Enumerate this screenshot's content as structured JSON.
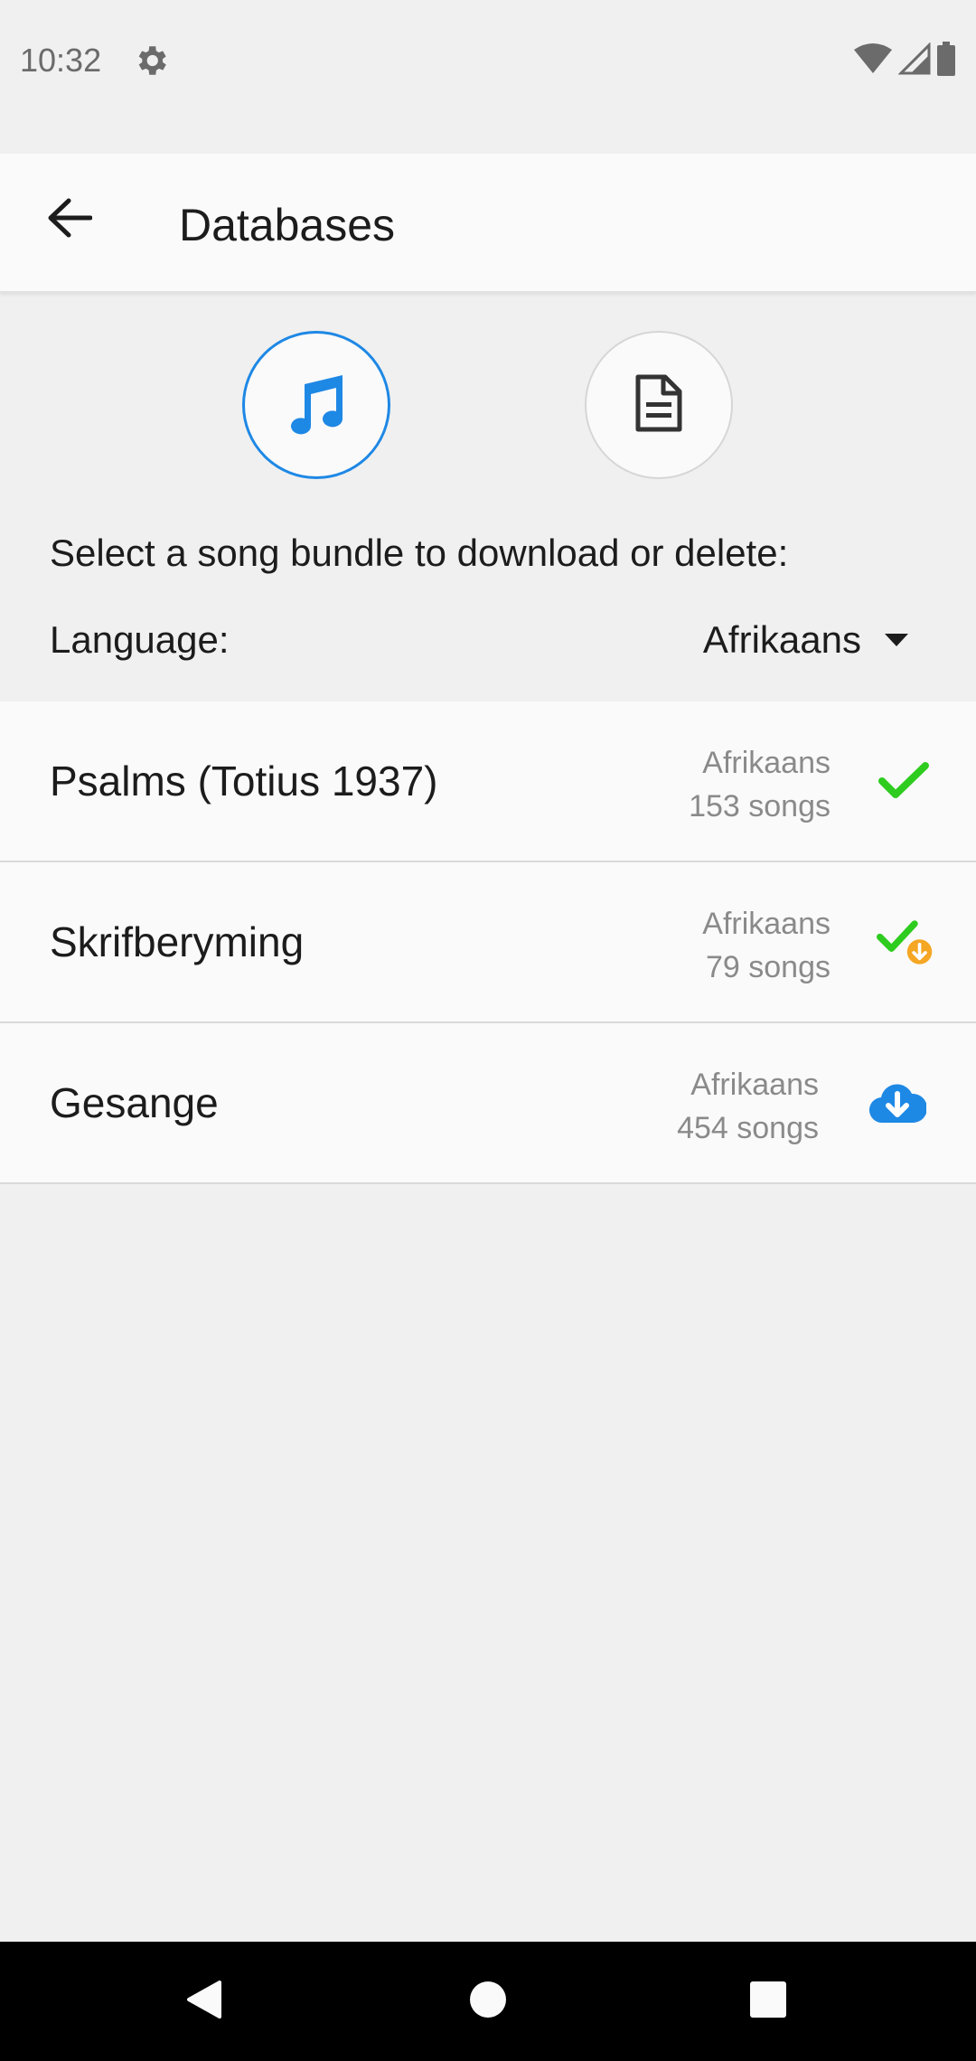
{
  "status_bar": {
    "time": "10:32",
    "icons": [
      "gear-icon",
      "wifi-icon",
      "signal-icon",
      "battery-icon"
    ]
  },
  "app_bar": {
    "title": "Databases",
    "back_icon": "arrow-back-icon"
  },
  "toggles": [
    {
      "name": "songs",
      "icon": "music-note-icon",
      "selected": true
    },
    {
      "name": "documents",
      "icon": "document-icon",
      "selected": false
    }
  ],
  "prompt": "Select a song bundle to download or delete:",
  "language": {
    "label": "Language:",
    "selected": "Afrikaans"
  },
  "bundles": [
    {
      "name": "Psalms (Totius 1937)",
      "language": "Afrikaans",
      "count": "153 songs",
      "status_icon": "check-icon"
    },
    {
      "name": "Skrifberyming",
      "language": "Afrikaans",
      "count": "79 songs",
      "status_icon": "check-update-icon"
    },
    {
      "name": "Gesange",
      "language": "Afrikaans",
      "count": "454 songs",
      "status_icon": "cloud-download-icon"
    }
  ],
  "colors": {
    "accent": "#1e88e5",
    "installed": "#2ecc1f",
    "update": "#f5a623",
    "background": "#f0f0f0",
    "surface": "#fafafa"
  },
  "nav_bar": {
    "icons": [
      "back-triangle-icon",
      "home-circle-icon",
      "recents-square-icon"
    ]
  }
}
